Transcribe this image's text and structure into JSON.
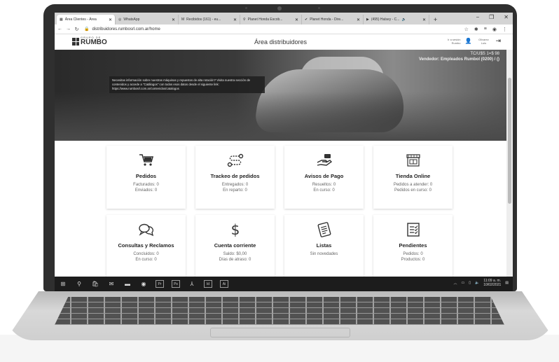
{
  "browser": {
    "tabs": [
      {
        "label": "Área Clientes - Área",
        "active": true
      },
      {
        "label": "WhatsApp"
      },
      {
        "label": "Recibidos (161) - eu..."
      },
      {
        "label": "Planet Honda Escob..."
      },
      {
        "label": "Planet Honda - Dire..."
      },
      {
        "label": "(495) Halsey - C..."
      }
    ],
    "new_tab": "+",
    "window_controls": {
      "minimize": "−",
      "maximize": "❐",
      "close": "✕"
    },
    "url": "distribuidores.rumbosrl.com.ar/home"
  },
  "header": {
    "logo_small": "GRUPO DE",
    "logo_big": "RUMBO",
    "title": "Área distribuidores",
    "switch_label": "Ir a sesión Rumbo",
    "user": "Olivarez Luis"
  },
  "hero": {
    "tc_label": "TC/U$S 1=$ 98",
    "seller": "Vendedor: Empleados Rumbol (0200) / ()",
    "note": "Necesitas información sobre nuestras máquinas y repuestos de alta rotación? Visita nuestra sección de contenidos y accede a \"Catálogos\" con todos esos datos desde el siguiente link: https://www.rumbosrl.com.ar/contenidos/catalogos"
  },
  "cards": [
    {
      "icon": "cart-icon",
      "title": "Pedidos",
      "lines": [
        "Facturados: 0",
        "Enviados: 0"
      ]
    },
    {
      "icon": "route-icon",
      "title": "Trackeo de pedidos",
      "lines": [
        "Entregados: 0",
        "En reparto: 0"
      ]
    },
    {
      "icon": "hand-coins-icon",
      "title": "Avisos de Pago",
      "lines": [
        "Resueltos: 0",
        "En curso: 0"
      ]
    },
    {
      "icon": "store-icon",
      "title": "Tienda Online",
      "lines": [
        "Pedidos a atender: 0",
        "Pedidos en curso: 0"
      ]
    },
    {
      "icon": "chat-bubbles-icon",
      "title": "Consultas y Reclamos",
      "lines": [
        "Concluidos: 0",
        "En curso: 0"
      ]
    },
    {
      "icon": "dollar-icon",
      "title": "Cuenta corriente",
      "lines": [
        "Saldo: $0,00",
        "Días de atraso: 0"
      ]
    },
    {
      "icon": "list-doc-icon",
      "title": "Listas",
      "lines": [
        "Sin novedades"
      ]
    },
    {
      "icon": "checklist-icon",
      "title": "Pendientes",
      "lines": [
        "Pedidos: 0",
        "Productos: 0"
      ]
    }
  ],
  "taskbar": {
    "time": "11:09 a. m.",
    "date": "10/02/2021",
    "apps": [
      "Pr",
      "Ps",
      "Ai"
    ]
  }
}
